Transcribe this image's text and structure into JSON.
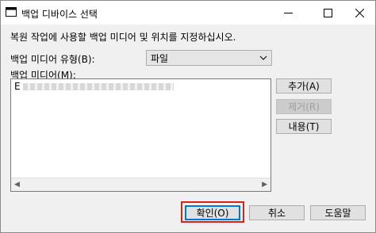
{
  "window": {
    "title": "백업 디바이스 선택"
  },
  "instruction": "복원 작업에 사용할 백업 미디어 및 위치를 지정하십시오.",
  "media_type": {
    "label": "백업 미디어 유형(B):",
    "selected": "파일"
  },
  "media_list": {
    "label": "백업 미디어(M):",
    "items": [
      "E"
    ]
  },
  "buttons": {
    "add": "추가(A)",
    "remove": "제거(R)",
    "contents": "내용(T)",
    "ok": "확인(O)",
    "cancel": "취소",
    "help": "도움말"
  },
  "colors": {
    "highlight": "#d9231a",
    "default_border": "#0078d7"
  }
}
